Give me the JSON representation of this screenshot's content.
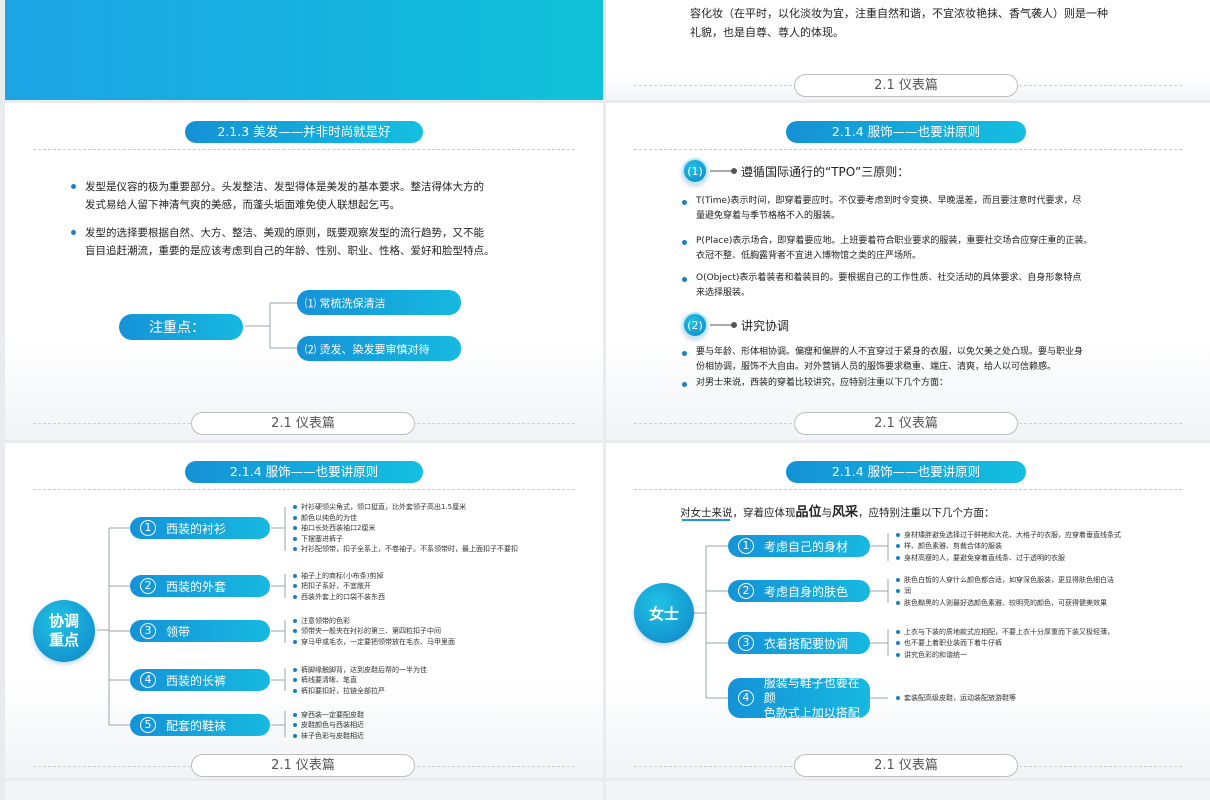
{
  "footer_label": "2.1 仪表篇",
  "slide2": {
    "text_line1": "容化妆（在平时，以化淡妆为宜，注重自然和谐，不宜浓妆艳抹、香气袭人）则是一种",
    "text_line2": "礼貌，也是自尊、尊人的体现。"
  },
  "slide3": {
    "header": "2.1.3 美发——并非时尚就是好",
    "bullet1_line1": "发型是仪容的极为重要部分。头发整洁、发型得体是美发的基本要求。整洁得体大方的",
    "bullet1_line2": "发式易给人留下神清气爽的美感，而蓬头垢面难免使人联想起乞丐。",
    "bullet2_line1": "发型的选择要根据自然、大方、整洁、美观的原则，既要观察发型的流行趋势，又不能",
    "bullet2_line2": "盲目追赶潮流，重要的是应该考虑到自己的年龄、性别、职业、性格、爱好和脸型特点。",
    "key_label": "注重点：",
    "item1": "⑴ 常梳洗保清洁",
    "item2": "⑵ 烫发、染发要审慎对待"
  },
  "slide4": {
    "header": "2.1.4  服饰——也要讲原则",
    "s1_num": "(1)",
    "s1_title": "遵循国际通行的“TPO”三原则：",
    "b1_line1": "T(Time)表示时间，即穿着要应时。不仅要考虑到时令变换、早晚温差，而且要注意时代要求，尽",
    "b1_line2": "量避免穿着与季节格格不入的服装。",
    "b2_line1": "P(Place)表示场合，即穿着要应地。上班要着符合职业要求的服装，重要社交场合应穿庄重的正装。",
    "b2_line2": "衣冠不整、低胸露背者不宜进入博物馆之类的庄严场所。",
    "b3_line1": "O(Object)表示着装者和着装目的。要根据自己的工作性质、社交活动的具体要求、自身形象特点",
    "b3_line2": "来选择服装。",
    "s2_num": "(2)",
    "s2_title": "讲究协调",
    "b4_line1": "要与年龄、形体相协调。偏瘦和偏胖的人不宜穿过于紧身的衣服，以免欠美之处凸现。要与职业身",
    "b4_line2": "份相协调，服饰不大自由。对外营销人员的服饰要求稳重、端庄、清爽，给人以可信赖感。",
    "b5_line1": "对男士来说，西装的穿着比较讲究，应特别注重以下几个方面："
  },
  "slide5": {
    "header": "2.1.4  服饰——也要讲原则",
    "center_label": "协调重点",
    "items": [
      {
        "num": "1",
        "label": "西装的衬衫",
        "notes": [
          "衬衫硬领尖角式，领口挺直，比外套领子高出1.5厘米",
          "颜色以纯色的为佳",
          "袖口长处西装袖口2厘米",
          "下摆塞进裤子",
          "衬衫配领带，扣子全系上，不卷袖子。不系领带时，最上面扣子不要扣"
        ]
      },
      {
        "num": "2",
        "label": "西装的外套",
        "notes": [
          "袖子上的商标(小布条)剪掉",
          "把扣子系好，不宜敞开",
          "西装外套上的口袋不装东西"
        ]
      },
      {
        "num": "3",
        "label": "领带",
        "notes": [
          "注意领带的色彩",
          "领带夹一般夹在衬衫的第三、第四粒扣子中间",
          "穿马甲或毛衣，一定要把领带放在毛衣、马甲里面"
        ]
      },
      {
        "num": "4",
        "label": "西装的长裤",
        "notes": [
          "裤脚缘触脚背，达到皮鞋后帮的一半为佳",
          "裤线要清晰、笔直",
          "裤扣要扣好，拉链全部拉严"
        ]
      },
      {
        "num": "5",
        "label": "配套的鞋袜",
        "notes": [
          "穿西装一定要配皮鞋",
          "皮鞋颜色与西装相近",
          "袜子色彩与皮鞋相近"
        ]
      }
    ]
  },
  "slide6": {
    "header": "2.1.4  服饰——也要讲原则",
    "intro_a": "对女士来说，穿着应体现",
    "intro_b": "品位",
    "intro_c": "与",
    "intro_d": "风采",
    "intro_e": "，应特别注重以下几个方面：",
    "center_label": "女士",
    "items": [
      {
        "num": "1",
        "label": "考虑自己的身材",
        "notes": [
          "身材矮胖避免选择过于鲜艳和大花、大格子的衣服，应穿着垂直线条式",
          "样、颜色素雅、剪裁合体的服装",
          "身材高瘦的人，要避免穿着直线条、过于透明的衣服"
        ]
      },
      {
        "num": "2",
        "label": "考虑自身的肤色",
        "notes": [
          "肤色白皙的人穿什么颜色都合适，如穿深色服装，更显得肤色细白洁",
          "润",
          "肤色黝黑的人则最好选颜色素雅、较明亮的颜色，可获得健美效果"
        ]
      },
      {
        "num": "3",
        "label": "衣着搭配要协调",
        "notes": [
          "上衣与下装的质地款式应相配，不要上衣十分厚重而下装又极轻薄，",
          "也不要上着职业装而下着牛仔裤",
          "讲究色彩的和谐统一"
        ]
      },
      {
        "num": "4",
        "label_line1": "服装与鞋子也要在颜",
        "label_line2": "色款式上加以搭配",
        "notes": [
          "套装配高级皮鞋，运动装配旅游鞋等"
        ]
      }
    ]
  }
}
